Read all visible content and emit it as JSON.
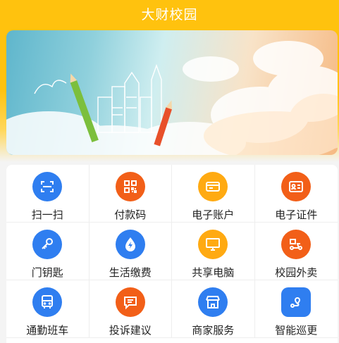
{
  "app": {
    "title": "大财校园"
  },
  "banner": {
    "image_name": "sky-pencils-banner"
  },
  "services": [
    {
      "label": "扫一扫",
      "icon": "scan-icon",
      "color": "#2f7ef0"
    },
    {
      "label": "付款码",
      "icon": "qr-code-icon",
      "color": "#f25f18"
    },
    {
      "label": "电子账户",
      "icon": "card-icon",
      "color": "#ffaa12"
    },
    {
      "label": "电子证件",
      "icon": "id-card-icon",
      "color": "#f25f18"
    },
    {
      "label": "门钥匙",
      "icon": "key-icon",
      "color": "#2f7ef0"
    },
    {
      "label": "生活缴费",
      "icon": "water-drop-bolt-icon",
      "color": "#2f7ef0"
    },
    {
      "label": "共享电脑",
      "icon": "monitor-icon",
      "color": "#ffaa12"
    },
    {
      "label": "校园外卖",
      "icon": "delivery-scooter-icon",
      "color": "#f25f18"
    },
    {
      "label": "通勤班车",
      "icon": "bus-icon",
      "color": "#2f7ef0"
    },
    {
      "label": "投诉建议",
      "icon": "chat-bubble-icon",
      "color": "#f25f18"
    },
    {
      "label": "商家服务",
      "icon": "shop-icon",
      "color": "#2f7ef0"
    },
    {
      "label": "智能巡更",
      "icon": "route-map-icon",
      "color": "#2f7ef0"
    }
  ]
}
